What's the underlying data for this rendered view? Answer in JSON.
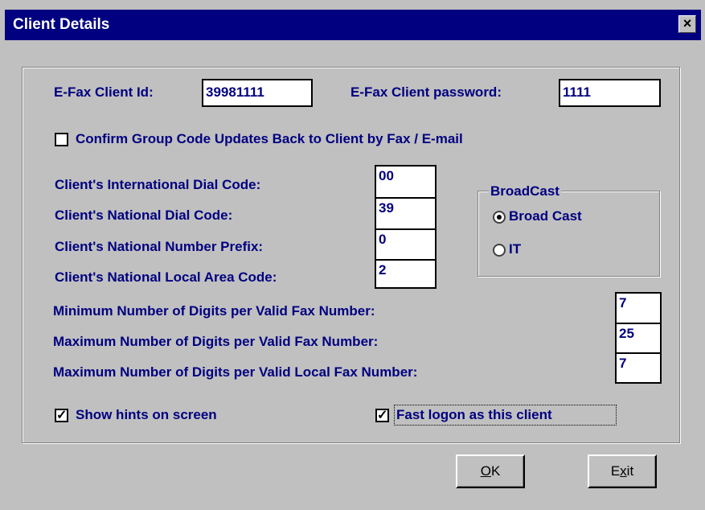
{
  "window": {
    "title": "Client Details",
    "close_glyph": "×"
  },
  "efax": {
    "client_id_label": "E-Fax Client Id:",
    "client_id_value": "39981111",
    "password_label": "E-Fax Client password:",
    "password_value": "1111"
  },
  "confirm_updates": {
    "label": "Confirm Group Code Updates Back to Client by Fax / E-mail",
    "checked": false
  },
  "dial_codes": {
    "international_label": "Client's International Dial Code:",
    "international_value": "00",
    "national_label": "Client's National Dial Code:",
    "national_value": "39",
    "prefix_label": "Client's National Number Prefix:",
    "prefix_value": "0",
    "local_area_label": "Client's National Local Area Code:",
    "local_area_value": "2"
  },
  "broadcast": {
    "group_label": "BroadCast",
    "option_broadcast": "Broad Cast",
    "option_it": "IT",
    "selected": "Broad Cast"
  },
  "digits": {
    "min_label": "Minimum Number of Digits per Valid Fax Number:",
    "min_value": "7",
    "max_label": "Maximum Number of Digits per Valid Fax Number:",
    "max_value": "25",
    "max_local_label": "Maximum Number of Digits per Valid Local Fax Number:",
    "max_local_value": "7"
  },
  "options": {
    "show_hints_label": "Show hints on screen",
    "show_hints_checked": true,
    "fast_logon_label": "Fast logon as this client",
    "fast_logon_checked": true,
    "check_glyph": "✓"
  },
  "buttons": {
    "ok_mnemonic": "O",
    "ok_rest": "K",
    "exit_first": "E",
    "exit_mnemonic": "x",
    "exit_rest": "it"
  }
}
